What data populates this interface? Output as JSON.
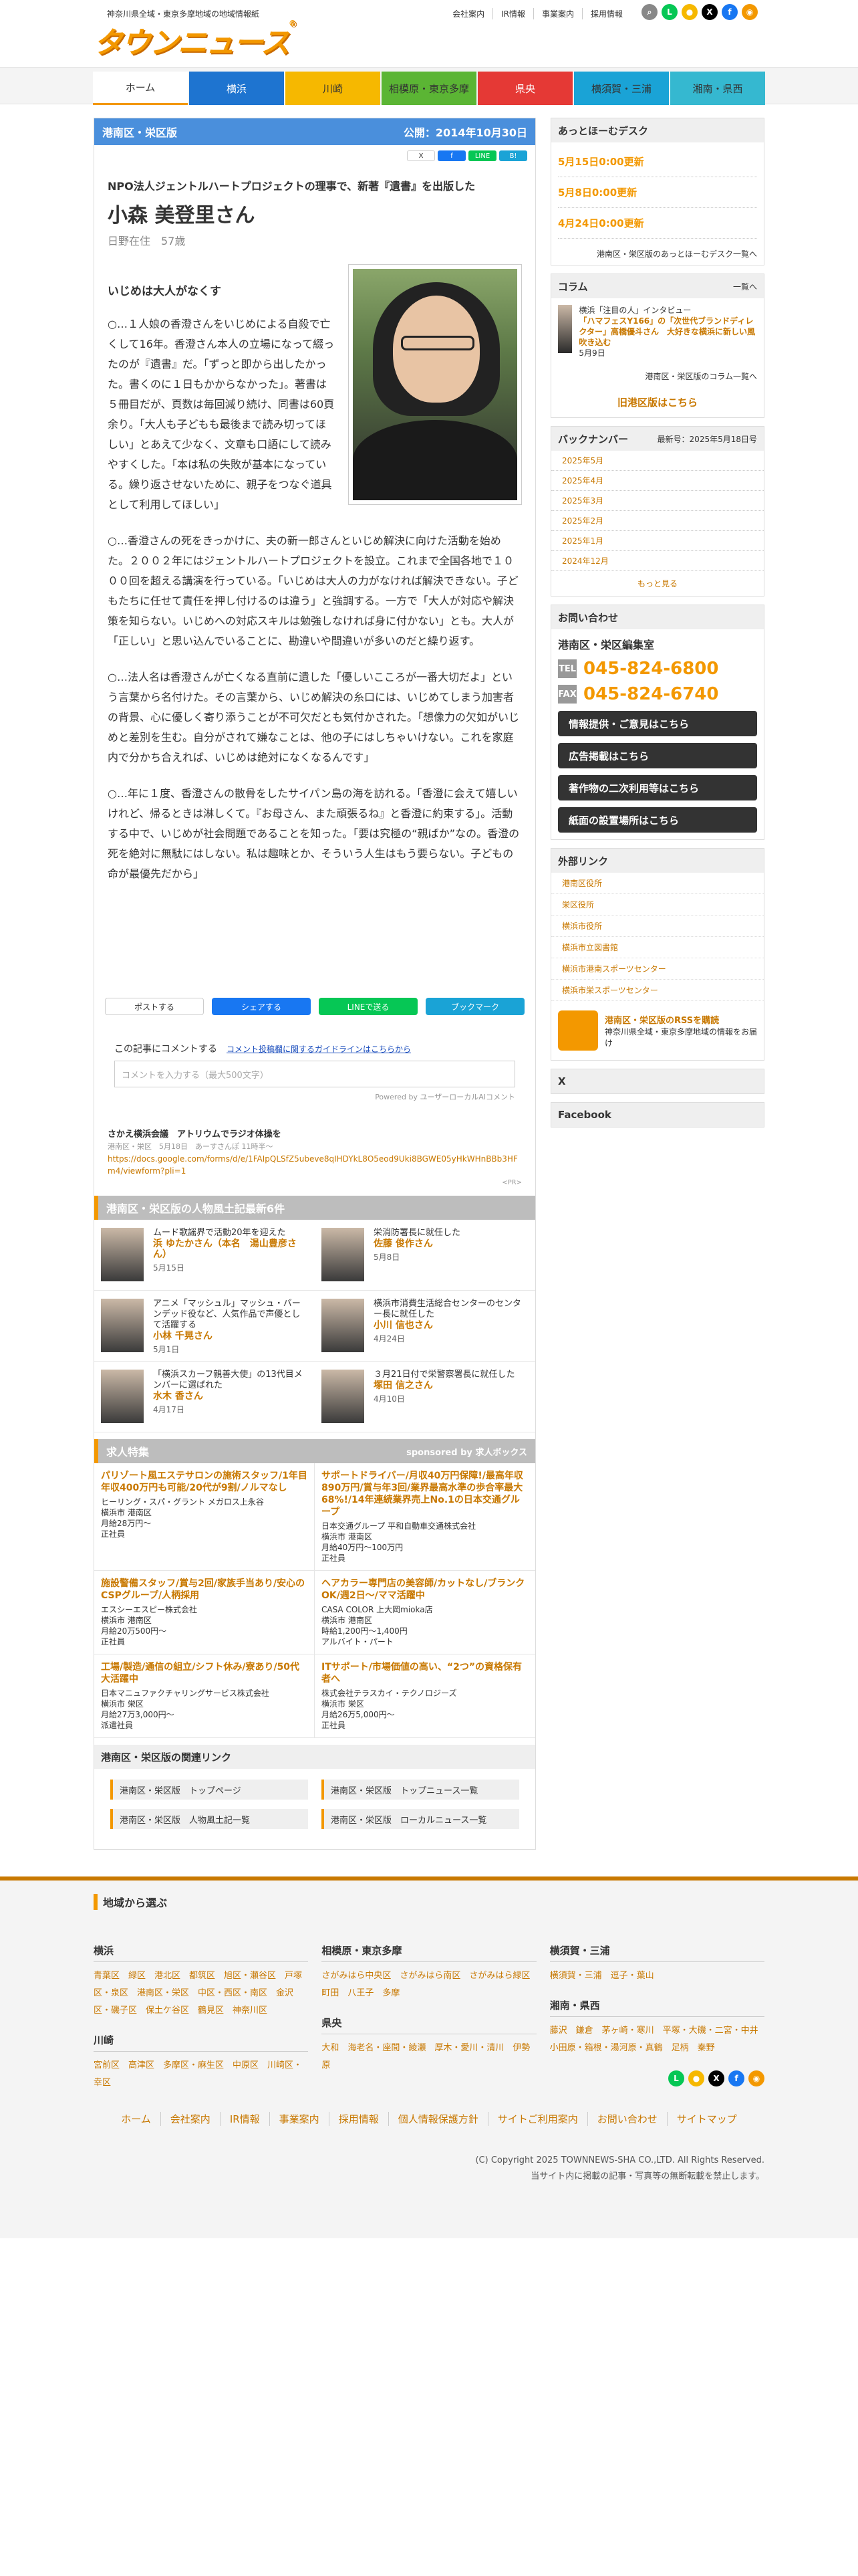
{
  "header": {
    "tagline": "神奈川県全域・東京多摩地域の地域情報紙",
    "logo": "タウンニュース",
    "logo_mark": "®",
    "links": [
      "会社案内",
      "IR情報",
      "事業案内",
      "採用情報"
    ]
  },
  "nav": {
    "tabs": [
      {
        "label": "ホーム",
        "color": "#ffffff"
      },
      {
        "label": "横浜",
        "color": "#1e74d0"
      },
      {
        "label": "川崎",
        "color": "#f6b800"
      },
      {
        "label": "相模原・東京多摩",
        "color": "#5bb534"
      },
      {
        "label": "県央",
        "color": "#e53935"
      },
      {
        "label": "横須賀・三浦",
        "color": "#1aa3d6"
      },
      {
        "label": "湘南・県西",
        "color": "#35b8d0"
      }
    ]
  },
  "article": {
    "area": "港南区・栄区版",
    "published": "公開：2014年10月30日",
    "subtitle": "NPO法人ジェントルハートプロジェクトの理事で、新著『遺書』を出版した",
    "name": "小森 美登里さん",
    "meta": "日野在住　57歳",
    "lead": "いじめは大人がなくす",
    "paras": [
      "○…１人娘の香澄さんをいじめによる自殺で亡くして16年。香澄さん本人の立場になって綴ったのが『遺書』だ。「ずっと即から出したかった。書くのに１日もかからなかった」。著書は５冊目だが、頁数は毎回減り続け、同書は60頁余り。「大人も子どもも最後まで読み切ってほしい」とあえて少なく、文章も口語にして読みやすくした。「本は私の失敗が基本になっている。繰り返させないために、親子をつなぐ道具として利用してほしい」",
      "○…香澄さんの死をきっかけに、夫の新一郎さんといじめ解決に向けた活動を始めた。２００２年にはジェントルハートプロジェクトを設立。これまで全国各地で１０００回を超える講演を行っている。「いじめは大人の力がなければ解決できない。子どもたちに任せて責任を押し付けるのは違う」と強調する。一方で「大人が対応や解決策を知らない。いじめへの対応スキルは勉強しなければ身に付かない」とも。大人が「正しい」と思い込んでいることに、勘違いや間違いが多いのだと繰り返す。",
      "○…法人名は香澄さんが亡くなる直前に遺した「優しいこころが一番大切だよ」という言葉から名付けた。その言葉から、いじめ解決の糸口には、いじめてしまう加害者の背景、心に優しく寄り添うことが不可欠だとも気付かされた。「想像力の欠如がいじめと差別を生む。自分がされて嫌なことは、他の子にはしちゃいけない。これを家庭内で分かち合えれば、いじめは絶対になくなるんです」",
      "○…年に１度、香澄さんの散骨をしたサイパン島の海を訪れる。「香澄に会えて嬉しいけれど、帰るときは淋しくて。『お母さん、また頑張るね』と香澄に約束する」。活動する中で、いじめが社会問題であることを知った。「要は究極の“親ばか”なの。香澄の死を絶対に無駄にはしない。私は趣味とか、そういう人生はもう要らない。子どもの命が最優先だから」"
    ],
    "share": [
      "ポストする",
      "シェアする",
      "LINEで送る",
      "ブックマーク"
    ],
    "share_mini": [
      "X",
      "f",
      "LINE",
      "B!"
    ]
  },
  "comment": {
    "label": "この記事にコメントする",
    "guide": "コメント投稿欄に関するガイドラインはこちらから",
    "placeholder": "コメントを入力する（最大500文字）",
    "powered": "Powered by ユーザーローカルAIコメント"
  },
  "pr": {
    "title": "さかえ横浜会議　アトリウムでラジオ体操を",
    "meta": "港南区・栄区　5月18日　あーすさんぽ 11時半〜",
    "url": "https://docs.google.com/forms/d/e/1FAIpQLSfZ5ubeve8qIHDYkL8O5eod9Uki8BGWE05yHkWHnBBb3HFm4/viewform?pli=1",
    "tag": "<PR>"
  },
  "people": {
    "heading": "港南区・栄区版の人物風土記最新6件",
    "items": [
      {
        "desc": "ムード歌謡界で活動20年を迎えた",
        "name": "浜 ゆたかさん（本名　湯山豊彦さん）",
        "date": "5月15日"
      },
      {
        "desc": "栄消防署長に就任した",
        "name": "佐藤 俊作さん",
        "date": "5月8日"
      },
      {
        "desc": "アニメ「マッシュル」マッシュ・バーンデッド役など、人気作品で声優として活躍する",
        "name": "小林 千晃さん",
        "date": "5月1日"
      },
      {
        "desc": "横浜市消費生活総合センターのセンター長に就任した",
        "name": "小川 信也さん",
        "date": "4月24日"
      },
      {
        "desc": "「横浜スカーフ親善大使」の13代目メンバーに選ばれた",
        "name": "水木 香さん",
        "date": "4月17日"
      },
      {
        "desc": "３月21日付で栄警察署長に就任した",
        "name": "塚田 信之さん",
        "date": "4月10日"
      }
    ]
  },
  "jobs": {
    "heading": "求人特集",
    "sponsor": "sponsored by 求人ボックス",
    "items": [
      {
        "title": "パリゾート風エステサロンの施術スタッフ/1年目年収400万円も可能/20代が9割/ノルマなし",
        "company": "ヒーリング・スパ・グラント メガロス上永谷",
        "loc": "横浜市 港南区",
        "pay": "月給28万円〜",
        "type": "正社員"
      },
      {
        "title": "サポートドライバー/月収40万円保障!/最高年収890万円/賞与年3回/業界最高水準の歩合率最大68%!/14年連続業界売上No.1の日本交通グループ",
        "company": "日本交通グループ 平和自動車交通株式会社",
        "loc": "横浜市 港南区",
        "pay": "月給40万円〜100万円",
        "type": "正社員"
      },
      {
        "title": "施設警備スタッフ/賞与2回/家族手当あり/安心のCSPグループ/人柄採用",
        "company": "エスシーエスピー株式会社",
        "loc": "横浜市 港南区",
        "pay": "月給20万500円〜",
        "type": "正社員"
      },
      {
        "title": "ヘアカラー専門店の美容師/カットなし/ブランクOK/週2日〜/ママ活躍中",
        "company": "CASA COLOR 上大岡mioka店",
        "loc": "横浜市 港南区",
        "pay": "時給1,200円〜1,400円",
        "type": "アルバイト・パート"
      },
      {
        "title": "工場/製造/通信の組立/シフト休み/寮あり/50代大活躍中",
        "company": "日本マニュファクチャリングサービス株式会社",
        "loc": "横浜市 栄区",
        "pay": "月給27万3,000円〜",
        "type": "派遣社員"
      },
      {
        "title": "ITサポート/市場価値の高い、“2つ”の資格保有者へ",
        "company": "株式会社テラスカイ・テクノロジーズ",
        "loc": "横浜市 栄区",
        "pay": "月給26万5,000円〜",
        "type": "正社員"
      }
    ]
  },
  "related": {
    "heading": "港南区・栄区版の関連リンク",
    "links": [
      "港南区・栄区版　トップページ",
      "港南区・栄区版　トップニュース一覧",
      "港南区・栄区版　人物風土記一覧",
      "港南区・栄区版　ローカルニュース一覧"
    ]
  },
  "sidebar": {
    "desk_title": "あっとほーむデスク",
    "desk_items": [
      "5月15日0:00更新",
      "5月8日0:00更新",
      "4月24日0:00更新"
    ],
    "desk_more": "港南区・栄区版のあっとほーむデスク一覧へ",
    "column_title": "コラム",
    "column_more_short": "一覧へ",
    "column_lead": "横浜「注目の人」インタビュー",
    "column_title_link": "「ハマフェスY166」の「次世代ブランドディレクター」高橋優斗さん　大好きな横浜に新しい風吹き込む",
    "column_date": "5月9日",
    "column_more": "港南区・栄区版のコラム一覧へ",
    "old_link": "旧港区版はこちら",
    "back_title": "バックナンバー",
    "back_updated": "最新号：2025年5月18日号",
    "back_items": [
      "2025年5月",
      "2025年4月",
      "2025年3月",
      "2025年2月",
      "2025年1月",
      "2024年12月"
    ],
    "back_more": "もっと見る",
    "contact_title": "お問い合わせ",
    "contact_name": "港南区・栄区編集室",
    "tel_label": "TEL",
    "tel": "045-824-6800",
    "fax_label": "FAX",
    "fax": "045-824-6740",
    "buttons": [
      "情報提供・ご意見はこちら",
      "広告掲載はこちら",
      "著作物の二次利用等はこちら",
      "紙面の設置場所はこちら"
    ],
    "ext_title": "外部リンク",
    "ext_links": [
      "港南区役所",
      "栄区役所",
      "横浜市役所",
      "横浜市立図書館",
      "横浜市港南スポーツセンター",
      "横浜市栄スポーツセンター"
    ],
    "rss_title": "港南区・栄区版のRSSを購読",
    "rss_desc": "神奈川県全域・東京多摩地域の情報をお届け",
    "x_title": "X",
    "fb_title": "Facebook"
  },
  "footer": {
    "heading": "地域から選ぶ",
    "cols": [
      {
        "groups": [
          {
            "title": "横浜",
            "links": "青葉区　緑区　港北区　都筑区　旭区・瀬谷区　戸塚区・泉区　港南区・栄区　中区・西区・南区　金沢区・磯子区　保土ケ谷区　鶴見区　神奈川区"
          },
          {
            "title": "川崎",
            "links": "宮前区　高津区　多摩区・麻生区　中原区　川崎区・幸区"
          }
        ]
      },
      {
        "groups": [
          {
            "title": "相模原・東京多摩",
            "links": "さがみはら中央区　さがみはら南区　さがみはら緑区　町田　八王子　多摩"
          },
          {
            "title": "県央",
            "links": "大和　海老名・座間・綾瀬　厚木・愛川・清川　伊勢原"
          }
        ]
      },
      {
        "groups": [
          {
            "title": "横須賀・三浦",
            "links": "横須賀・三浦　逗子・葉山"
          },
          {
            "title": "湘南・県西",
            "links": "藤沢　鎌倉　茅ヶ崎・寒川　平塚・大磯・二宮・中井　小田原・箱根・湯河原・真鶴　足柄　秦野"
          }
        ]
      }
    ],
    "nav": [
      "ホーム",
      "会社案内",
      "IR情報",
      "事業案内",
      "採用情報",
      "個人情報保護方針",
      "サイトご利用案内",
      "お問い合わせ",
      "サイトマップ"
    ],
    "copyright": "(C) Copyright 2025 TOWNNEWS-SHA CO.,LTD. All Rights Reserved.",
    "notice": "当サイト内に掲載の記事・写真等の無断転載を禁止します。"
  }
}
